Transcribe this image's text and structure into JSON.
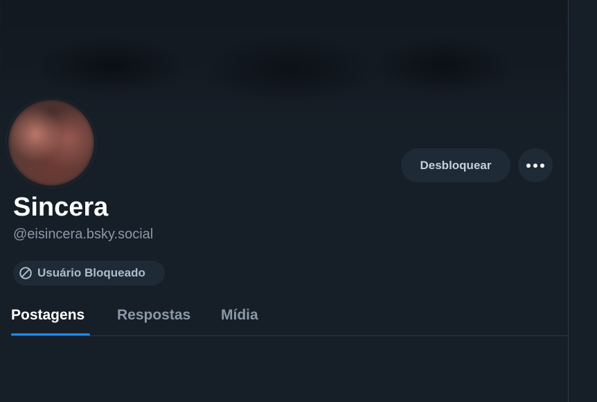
{
  "profile": {
    "display_name": "Sincera",
    "handle": "@eisincera.bsky.social",
    "blocked_badge_label": "Usuário Bloqueado"
  },
  "actions": {
    "unblock_label": "Desbloquear",
    "more_icon": "ellipsis-icon"
  },
  "tabs": [
    {
      "label": "Postagens",
      "active": true
    },
    {
      "label": "Respostas",
      "active": false
    },
    {
      "label": "Mídia",
      "active": false
    }
  ],
  "colors": {
    "background": "#161e27",
    "button_bg": "#1f2a37",
    "accent": "#1d8cf0",
    "text_primary": "#ffffff",
    "text_secondary": "#8b98a8"
  },
  "icons": {
    "blocked": "ban-icon",
    "more": "ellipsis-icon"
  }
}
